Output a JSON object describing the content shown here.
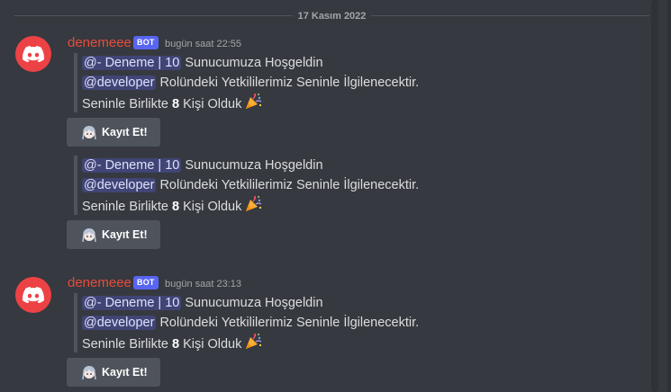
{
  "date_divider": "17 Kasım 2022",
  "messages": [
    {
      "username": "denemeee",
      "bot_tag": "BOT",
      "timestamp": "bugün saat 22:55",
      "embeds": [
        {
          "line1_mention": "@- Deneme | 10",
          "line1_text": "Sunucumuza Hoşgeldin",
          "line2_mention": "@developer",
          "line2_text": "Rolündeki Yetkililerimiz Seninle İlgilenecektir.",
          "line3_pre": "Seninle Birlikte",
          "line3_count": "8",
          "line3_post": "Kişi Olduk",
          "button_label": "Kayıt Et!"
        },
        {
          "line1_mention": "@- Deneme | 10",
          "line1_text": "Sunucumuza Hoşgeldin",
          "line2_mention": "@developer",
          "line2_text": "Rolündeki Yetkililerimiz Seninle İlgilenecektir.",
          "line3_pre": "Seninle Birlikte",
          "line3_count": "8",
          "line3_post": "Kişi Olduk",
          "button_label": "Kayıt Et!"
        }
      ]
    },
    {
      "username": "denemeee",
      "bot_tag": "BOT",
      "timestamp": "bugün saat 23:13",
      "embeds": [
        {
          "line1_mention": "@- Deneme | 10",
          "line1_text": "Sunucumuza Hoşgeldin",
          "line2_mention": "@developer",
          "line2_text": "Rolündeki Yetkililerimiz Seninle İlgilenecektir.",
          "line3_pre": "Seninle Birlikte",
          "line3_count": "8",
          "line3_post": "Kişi Olduk",
          "button_label": "Kayıt Et!"
        }
      ]
    }
  ],
  "icons": {
    "avatar": "discord-logo-icon",
    "party": "party-popper-icon",
    "button": "anime-girl-emoji-icon"
  },
  "colors": {
    "background": "#36393f",
    "username": "#e74c3c",
    "bot_tag": "#5865f2",
    "mention_bg": "#414675",
    "button_bg": "#4f545c",
    "avatar_bg": "#ed4245"
  }
}
